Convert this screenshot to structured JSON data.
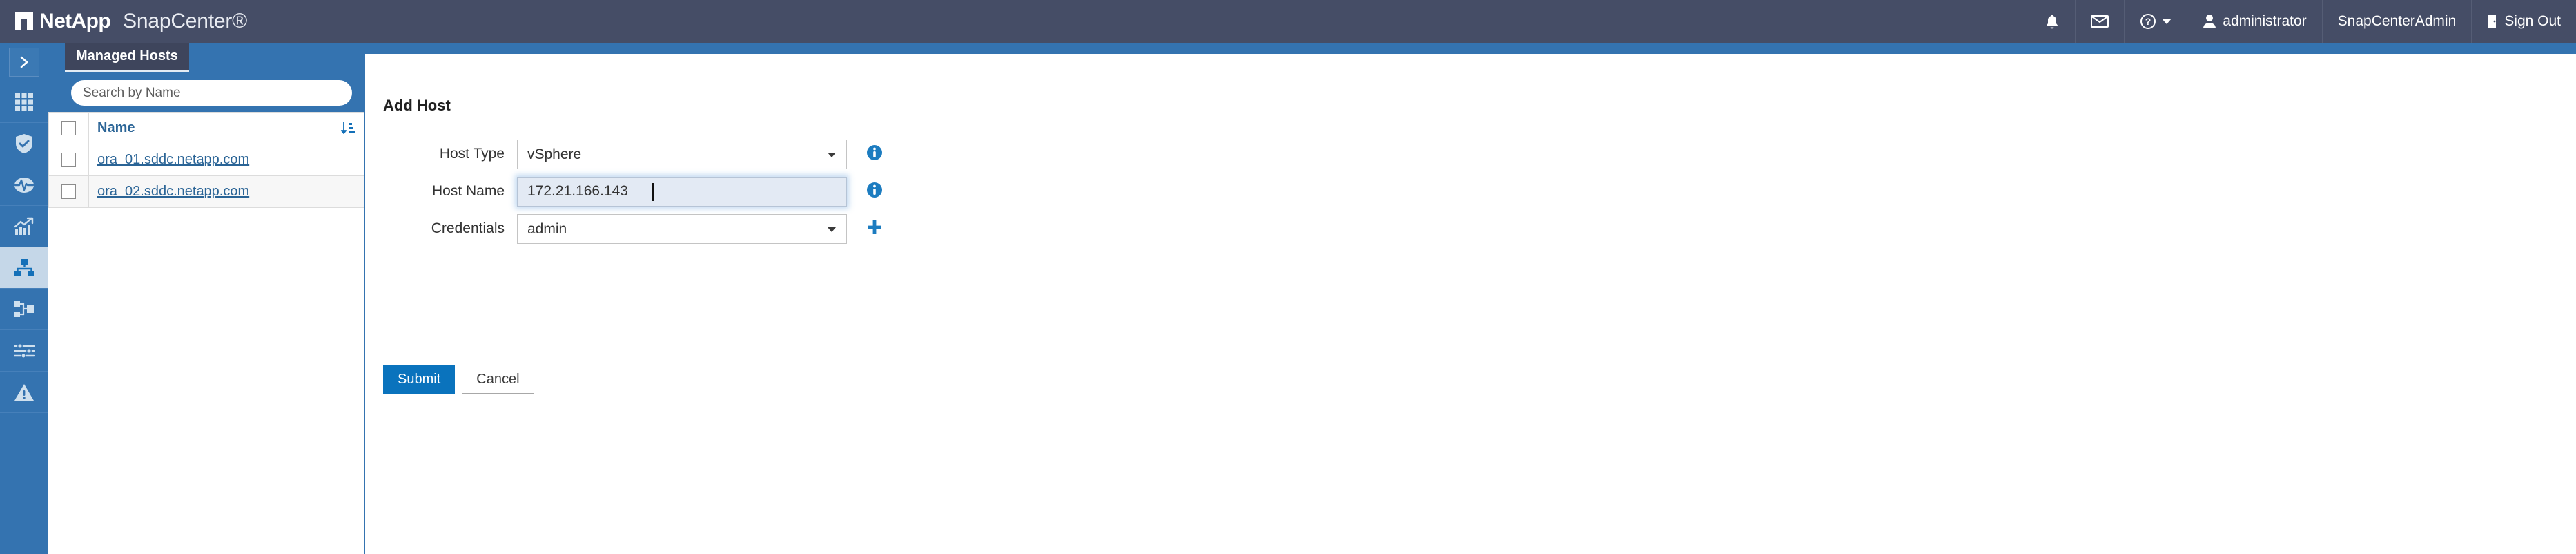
{
  "header": {
    "brand_netapp": "NetApp",
    "brand_product": "SnapCenter®",
    "notifications_icon": "bell-icon",
    "messages_icon": "envelope-icon",
    "help_icon": "question-circle-icon",
    "user_icon": "user-icon",
    "user_name": "administrator",
    "role": "SnapCenterAdmin",
    "signout_icon": "sign-out-icon",
    "signout_label": "Sign Out",
    "bg_color": "#454d66"
  },
  "sidebar": {
    "bg_color": "#3473b0",
    "active_bg_color": "#c5d7e8",
    "items": [
      {
        "name": "collapse-expand",
        "icon": "chevron-right-icon",
        "active": false
      },
      {
        "name": "dashboard",
        "icon": "grid-dashboard-icon",
        "active": false
      },
      {
        "name": "resources",
        "icon": "shield-check-icon",
        "active": false
      },
      {
        "name": "monitor",
        "icon": "pulse-monitor-icon",
        "active": false
      },
      {
        "name": "reports",
        "icon": "bar-chart-trend-icon",
        "active": false
      },
      {
        "name": "hosts",
        "icon": "sitemap-hosts-icon",
        "active": true
      },
      {
        "name": "storage-systems",
        "icon": "storage-nodes-icon",
        "active": false
      },
      {
        "name": "settings",
        "icon": "sliders-settings-icon",
        "active": false
      },
      {
        "name": "alerts",
        "icon": "warning-triangle-icon",
        "active": false
      }
    ]
  },
  "hosts_panel": {
    "tab_label": "Managed Hosts",
    "search": {
      "placeholder": "Search by Name",
      "value": ""
    },
    "table": {
      "columns": [
        "",
        "Name"
      ],
      "sort_icon": "sort-descending-icon",
      "rows": [
        {
          "checked": false,
          "name": "ora_01.sddc.netapp.com"
        },
        {
          "checked": false,
          "name": "ora_02.sddc.netapp.com"
        }
      ]
    }
  },
  "main": {
    "title": "Add Host",
    "fields": [
      {
        "label": "Host Type",
        "value": "vSphere",
        "options": [
          "vSphere"
        ],
        "control": "select",
        "affix_icon": "info-circle-icon",
        "focused": false
      },
      {
        "label": "Host Name",
        "value": "172.21.166.143",
        "placeholder": "",
        "control": "input",
        "affix_icon": "info-circle-icon",
        "focused": true
      },
      {
        "label": "Credentials",
        "value": "admin",
        "options": [
          "admin"
        ],
        "control": "select",
        "affix_icon": "plus-icon",
        "focused": false
      }
    ],
    "buttons": {
      "submit_label": "Submit",
      "cancel_label": "Cancel",
      "submit_color": "#0a73bd"
    }
  }
}
